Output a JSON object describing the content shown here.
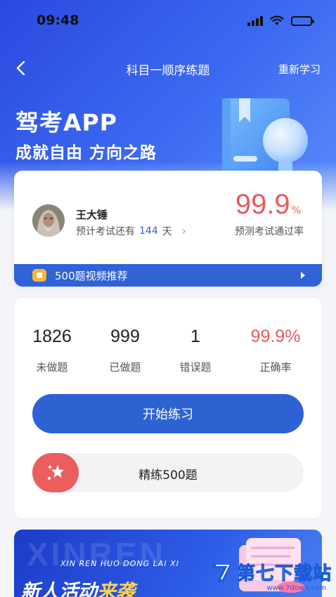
{
  "status_bar": {
    "time": "09:48"
  },
  "nav": {
    "title": "科目一顺序练题",
    "action": "重新学习"
  },
  "hero": {
    "title": "驾考APP",
    "subtitle": "成就自由  方向之路"
  },
  "user_card": {
    "name": "王大锤",
    "exam_prefix": "预计考试还有",
    "exam_days": "144",
    "exam_suffix": "天",
    "pass_rate": "99.9",
    "pass_unit": "%",
    "pass_label": "预测考试通过率",
    "video_label": "500题视频推荐"
  },
  "stats": [
    {
      "value": "1826",
      "label": "未做题"
    },
    {
      "value": "999",
      "label": "已做题"
    },
    {
      "value": "1",
      "label": "错误题"
    },
    {
      "value": "99.9%",
      "label": "正确率"
    }
  ],
  "buttons": {
    "start": "开始练习",
    "drill": "精练500题"
  },
  "banner": {
    "bg_word": "XINREN",
    "pinyin": "XIN REN HUO DONG LAI XI",
    "title_main": "新人活动",
    "title_highlight": "来袭"
  },
  "watermark": {
    "text": "第七下载站",
    "url": "www.7down.com"
  },
  "colors": {
    "primary": "#2e62d3",
    "accent_red": "#ea5a5a",
    "header": "#3c6af2"
  }
}
